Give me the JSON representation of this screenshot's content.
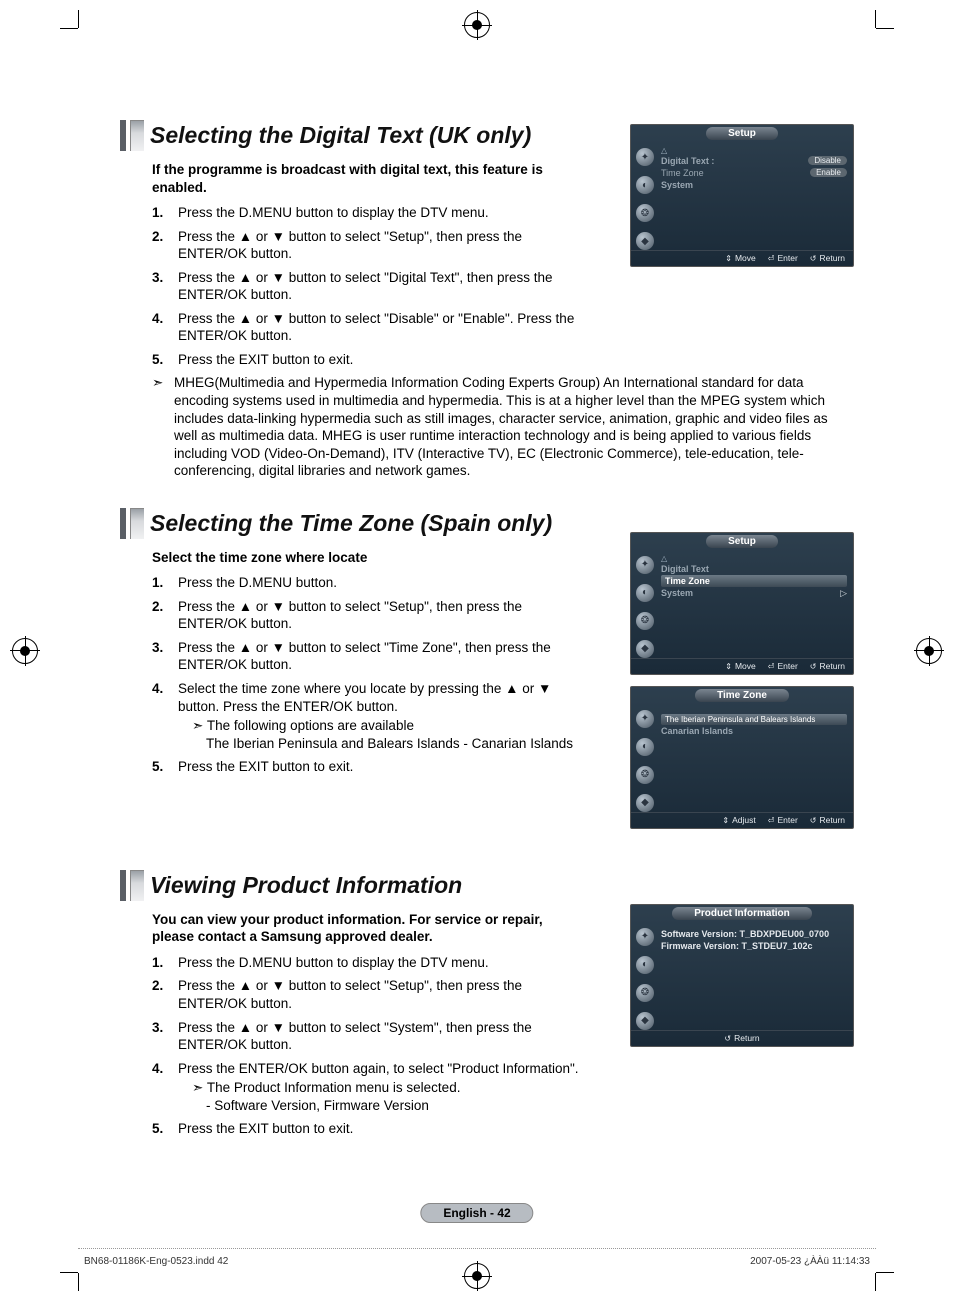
{
  "section1": {
    "title": "Selecting the Digital Text (UK only)",
    "intro": "If the programme is broadcast with digital text, this feature is enabled.",
    "steps": [
      "Press the D.MENU button to display the DTV menu.",
      "Press the ▲ or ▼ button to select \"Setup\", then press the ENTER/OK button.",
      "Press the ▲ or ▼ button to select \"Digital Text\", then press the ENTER/OK button.",
      "Press the ▲ or ▼ button to select \"Disable\" or \"Enable\". Press the ENTER/OK button.",
      "Press the EXIT button to exit."
    ],
    "note": "MHEG(Multimedia and Hypermedia Information Coding Experts Group) An International standard for data encoding systems used in multimedia and hypermedia. This is at a higher level than the MPEG system which includes data-linking hypermedia such as still images, character service, animation, graphic and video files as well as multimedia data. MHEG is user runtime interaction technology and is being applied to various fields including VOD (Video-On-Demand), ITV (Interactive TV), EC (Electronic Commerce), tele-education, tele-conferencing, digital libraries and network games.",
    "osd": {
      "title": "Setup",
      "rows": [
        {
          "label": "Digital Text :",
          "opt": "Disable",
          "sel": true
        },
        {
          "label": "Time Zone",
          "opt": "Enable"
        },
        {
          "label": "System"
        }
      ],
      "foot": [
        "Move",
        "Enter",
        "Return"
      ]
    }
  },
  "section2": {
    "title": "Selecting the Time Zone (Spain only)",
    "intro": "Select the time zone where locate",
    "steps": [
      "Press the D.MENU button.",
      "Press the ▲ or ▼ button to select \"Setup\", then press the ENTER/OK button.",
      "Press the ▲ or ▼ button to select \"Time Zone\", then press the ENTER/OK button.",
      "Select the time zone where you locate by pressing the ▲ or ▼ button. Press the ENTER/OK button.",
      "Press the EXIT button to exit."
    ],
    "sub4a": "The following options are available",
    "sub4b": "The Iberian Peninsula and Balears Islands - Canarian Islands",
    "osdA": {
      "title": "Setup",
      "rows": [
        {
          "label": "Digital Text"
        },
        {
          "label": "Time Zone",
          "sel": true
        },
        {
          "label": "System",
          "arrow": true
        }
      ],
      "foot": [
        "Move",
        "Enter",
        "Return"
      ]
    },
    "osdB": {
      "title": "Time Zone",
      "rows": [
        {
          "label": "The Iberian Peninsula and Balears Islands",
          "sel": true
        },
        {
          "label": "Canarian Islands"
        }
      ],
      "foot": [
        "Adjust",
        "Enter",
        "Return"
      ]
    }
  },
  "section3": {
    "title": "Viewing Product Information",
    "intro": "You can view your product information. For service or repair, please contact a Samsung approved dealer.",
    "steps": [
      "Press the D.MENU button to display the DTV menu.",
      "Press the ▲ or ▼ button to select \"Setup\", then press the ENTER/OK button.",
      "Press the ▲ or ▼ button to select \"System\", then press the ENTER/OK button.",
      "Press the ENTER/OK button again, to select \"Product Information\".",
      "Press the EXIT button to exit."
    ],
    "sub4a": "The Product Information menu is selected.",
    "sub4b": "- Software Version, Firmware Version",
    "osd": {
      "title": "Product Information",
      "line1": "Software Version: T_BDXPDEU00_0700",
      "line2": "Firmware Version: T_STDEU7_102c",
      "foot": [
        "Return"
      ]
    }
  },
  "pageBadge": "English - 42",
  "footer": {
    "left": "BN68-01186K-Eng-0523.indd   42",
    "right": "2007-05-23   ¿ÀÀü 11:14:33"
  }
}
